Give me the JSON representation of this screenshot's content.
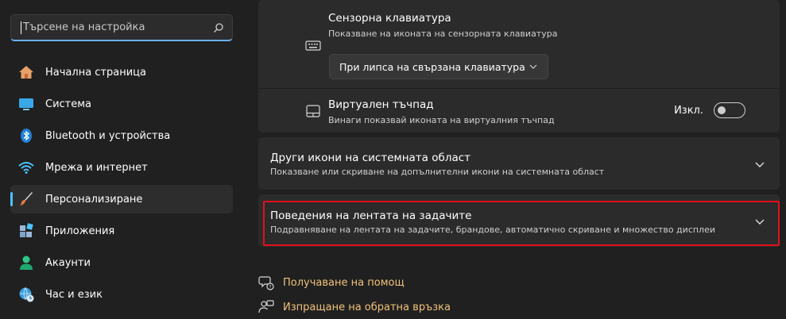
{
  "search": {
    "value": "Търсене на настройка"
  },
  "nav": [
    {
      "label": "Начална страница",
      "icon": "home-icon"
    },
    {
      "label": "Система",
      "icon": "system-icon"
    },
    {
      "label": "Bluetooth и устройства",
      "icon": "bluetooth-icon"
    },
    {
      "label": "Мрежа и интернет",
      "icon": "wifi-icon"
    },
    {
      "label": "Персонализиране",
      "icon": "brush-icon",
      "active": true
    },
    {
      "label": "Приложения",
      "icon": "apps-icon"
    },
    {
      "label": "Акаунти",
      "icon": "account-icon"
    },
    {
      "label": "Час и език",
      "icon": "time-language-icon"
    }
  ],
  "touch_keyboard": {
    "title": "Сензорна клавиатура",
    "subtitle": "Показване на иконата на сензорната клавиатура",
    "dropdown_value": "При липса на свързана клавиатура"
  },
  "virtual_touchpad": {
    "title": "Виртуален тъчпад",
    "subtitle": "Винаги показвай иконата на виртуалния тъчпад",
    "toggle_label": "Изкл."
  },
  "other_icons": {
    "title": "Други икони на системната област",
    "subtitle": "Показване или скриване на допълнителни икони на системната област"
  },
  "taskbar_behaviors": {
    "title": "Поведения на лентата на задачите",
    "subtitle": "Подравняване на лентата на задачите, брандове, автоматично скриване и множество дисплеи"
  },
  "links": {
    "help": "Получаване на помощ",
    "feedback": "Изпращане на обратна връзка"
  },
  "colors": {
    "accent": "#4cc2ff",
    "link": "#f0c27a",
    "highlight": "#e0111a"
  }
}
